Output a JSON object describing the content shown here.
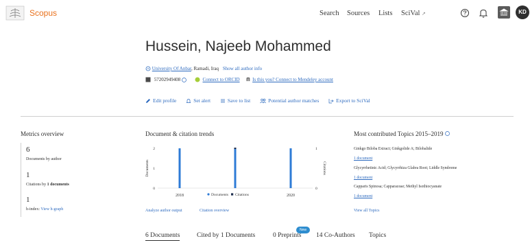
{
  "header": {
    "app_name": "Scopus",
    "nav": [
      "Search",
      "Sources",
      "Lists",
      "SciVal"
    ],
    "scival_arrow": "↗",
    "avatar_initials": "KD"
  },
  "author": {
    "name": "Hussein, Najeeb Mohammed",
    "affiliation": "University Of Anbar",
    "location": ", Ramadi, Iraq",
    "show_all_info": "Show all author info",
    "author_id": "57202949408",
    "orcid_link": "Connect to ORCID",
    "mendeley_link": "Is this you? Connect to Mendeley account"
  },
  "actions": [
    "Edit profile",
    "Set alert",
    "Save to list",
    "Potential author matches",
    "Export to SciVal"
  ],
  "metrics": {
    "title": "Metrics overview",
    "documents_value": "6",
    "documents_label": "Documents by author",
    "citations_value": "1",
    "citations_label_prefix": "Citations by ",
    "citations_label_bold": "1 documents",
    "hindex_value": "1",
    "hindex_label": "h-index:",
    "hindex_link": "View h-graph"
  },
  "trends": {
    "title": "Document & citation trends",
    "analyze_link": "Analyze author output",
    "citation_link": "Citation overview"
  },
  "chart_data": {
    "type": "bar",
    "x_ticks": [
      "2018",
      "2020"
    ],
    "xlim": [
      2018,
      2020
    ],
    "ylabel_left": "Documents",
    "ylabel_right": "Citations",
    "yticks_left": [
      "0",
      "1",
      "2"
    ],
    "yticks_right": [
      "0",
      "1"
    ],
    "ylim_left": [
      0,
      2
    ],
    "ylim_right": [
      0,
      1
    ],
    "series": [
      {
        "name": "Documents",
        "color": "#2e7bd6",
        "points": [
          [
            2018,
            2
          ],
          [
            2019,
            2
          ],
          [
            2020,
            2
          ]
        ]
      },
      {
        "name": "Citations",
        "color": "#1f2f4f",
        "points": [
          [
            2019,
            1
          ]
        ]
      }
    ]
  },
  "topics": {
    "title": "Most contributed Topics 2015–2019",
    "items": [
      {
        "name": "Ginkgo Biloba Extract; Ginkgolide A; Bilobalide",
        "docs": "1 document"
      },
      {
        "name": "Glycyrrhetinic Acid; Glycyrrhiza Glabra Root; Liddle Syndrome",
        "docs": "1 document"
      },
      {
        "name": "Capparis Spinosa; Capparaceae; Methyl Isothiocyanate",
        "docs": "1 document"
      }
    ],
    "view_all": "View all Topics"
  },
  "tabs": [
    "6 Documents",
    "Cited by 1 Documents",
    "0 Preprints",
    "14 Co-Authors",
    "Topics"
  ],
  "new_badge": "New"
}
